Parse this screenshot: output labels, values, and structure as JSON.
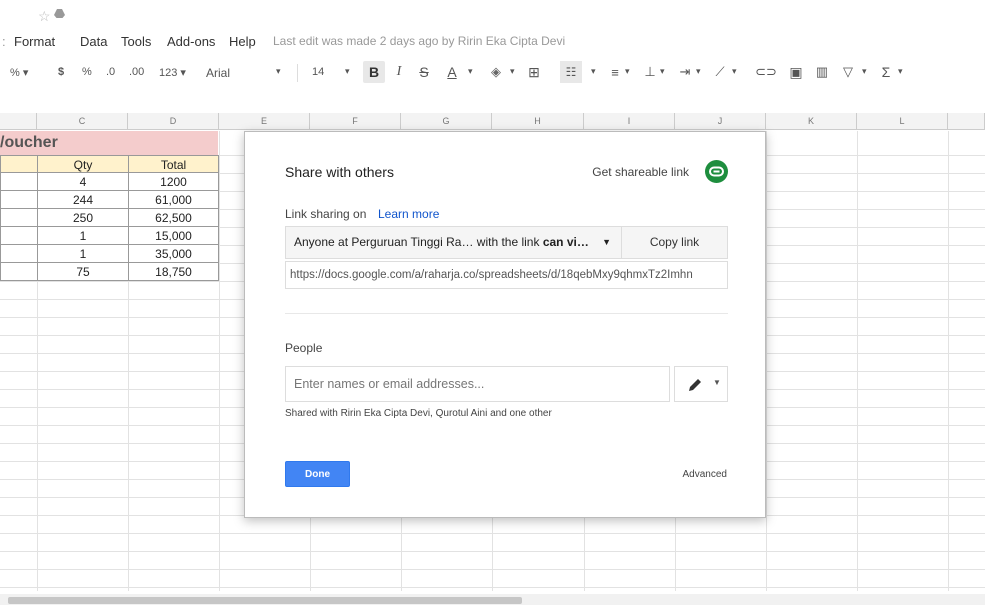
{
  "menubar": {
    "items": [
      "Format",
      "Data",
      "Tools",
      "Add-ons",
      "Help"
    ],
    "last_edit": "Last edit was made 2 days ago by Ririn Eka Cipta Devi"
  },
  "toolbar": {
    "percent": "%",
    "currency": "$",
    "percent2": "%",
    "dec_less": ".0",
    "dec_more": ".00",
    "more_formats": "123",
    "font": "Arial",
    "font_size": "14",
    "bold": "B",
    "italic": "I",
    "strike": "S",
    "textcolor": "A"
  },
  "grid": {
    "columns": [
      "C",
      "D",
      "E",
      "F",
      "G",
      "H",
      "I",
      "J",
      "K",
      "L"
    ],
    "title": "/oucher",
    "headers": [
      "Qty",
      "Total"
    ],
    "rows": [
      [
        "4",
        "1200"
      ],
      [
        "244",
        "61,000"
      ],
      [
        "250",
        "62,500"
      ],
      [
        "1",
        "15,000"
      ],
      [
        "1",
        "35,000"
      ],
      [
        "75",
        "18,750"
      ]
    ]
  },
  "dialog": {
    "title": "Share with others",
    "get_link": "Get shareable link",
    "link_sharing_label": "Link sharing on",
    "learn_more": "Learn more",
    "access_prefix": "Anyone at Perguruan Tinggi Ra… with the link ",
    "access_bold": "can vi…",
    "copy_link": "Copy link",
    "url": "https://docs.google.com/a/raharja.co/spreadsheets/d/18qebMxy9qhmxTz2Imhn",
    "people_label": "People",
    "names_placeholder": "Enter names or email addresses...",
    "shared_with": "Shared with Ririn Eka Cipta Devi, Qurotul Aini and one other",
    "done": "Done",
    "advanced": "Advanced"
  },
  "colors": {
    "accent_blue": "#4285f4",
    "link_green": "#1e8e3e",
    "voucher_bg": "#f4cccc",
    "header_bg": "#fff2cc"
  }
}
